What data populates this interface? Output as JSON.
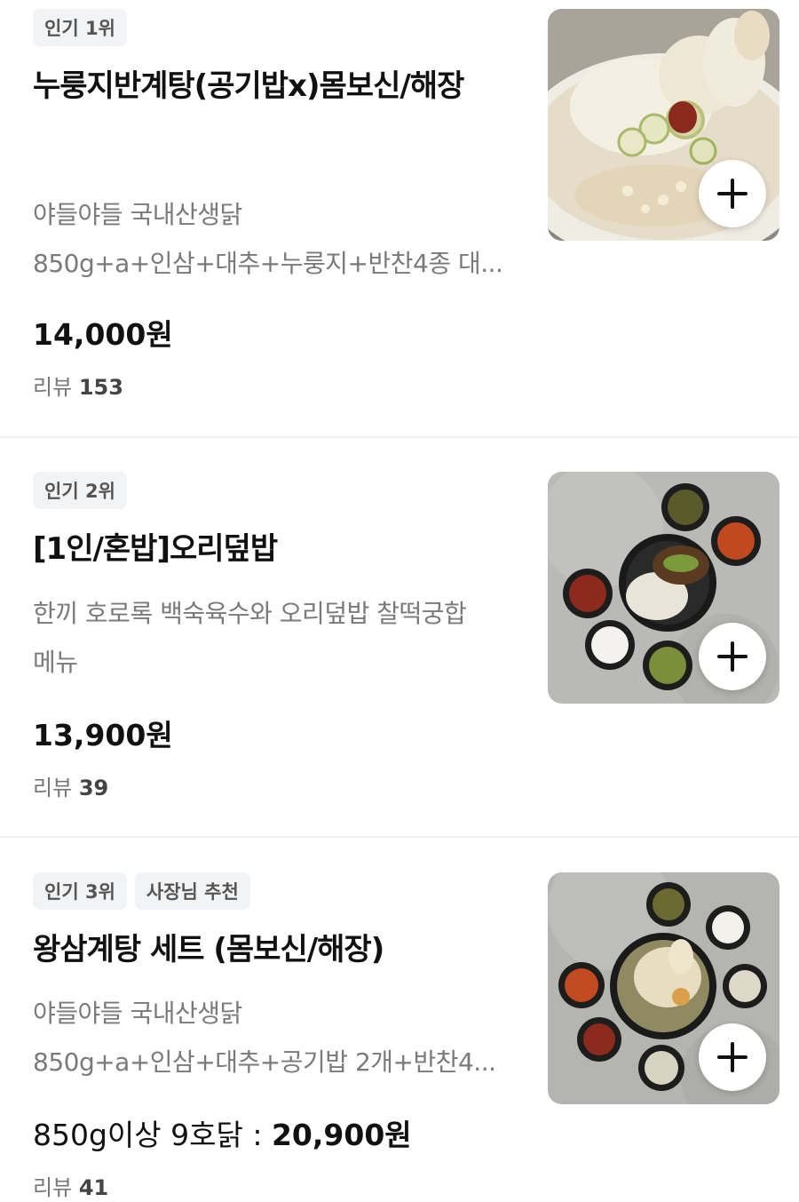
{
  "menu_items": [
    {
      "badges": [
        "인기 1위"
      ],
      "title": "누룽지반계탕(공기밥x)몸보신/해장",
      "desc_lines": [
        "야들야들 국내산생닭",
        "850g+a+인삼+대추+누룽지+반찬4종 대..."
      ],
      "price": "14,000원",
      "review_label": "리뷰",
      "review_count": "153",
      "image_icon": "samgyetang-bowl-photo"
    },
    {
      "badges": [
        "인기 2위"
      ],
      "title": "[1인/혼밥]오리덮밥",
      "desc_lines": [
        "한끼 호로록 백숙육수와 오리덮밥 찰떡궁합",
        "메뉴"
      ],
      "price": "13,900원",
      "review_label": "리뷰",
      "review_count": "39",
      "image_icon": "duck-rice-set-photo"
    },
    {
      "badges": [
        "인기 3위",
        "사장님 추천"
      ],
      "title": "왕삼계탕 세트 (몸보신/해장)",
      "desc_lines": [
        "야들야들 국내산생닭",
        "850g+a+인삼+대추+공기밥 2개+반찬4..."
      ],
      "price_option": "850g이상 9호닭 : ",
      "price": "20,900원",
      "review_label": "리뷰",
      "review_count": "41",
      "image_icon": "samgyetang-set-photo"
    }
  ]
}
